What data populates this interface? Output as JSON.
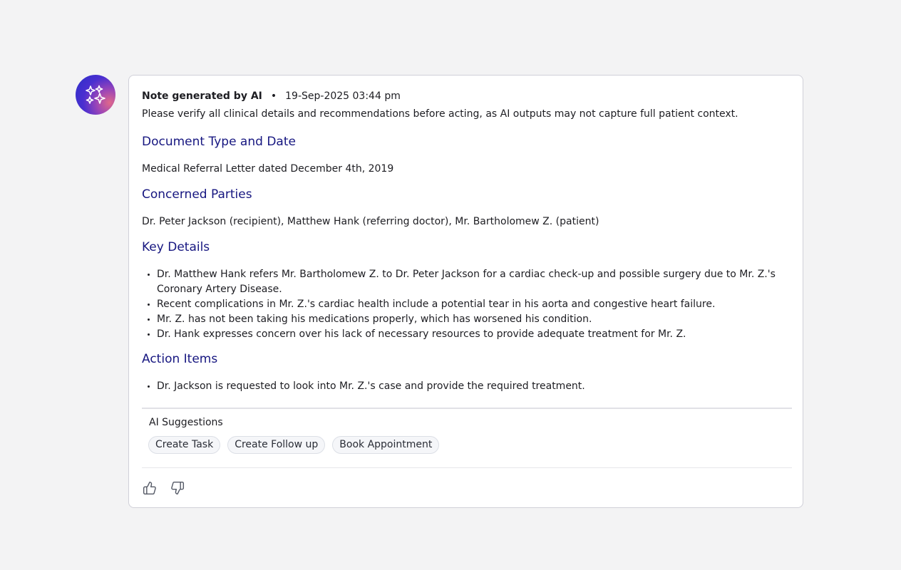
{
  "note": {
    "generated_label": "Note generated by AI",
    "separator": "•",
    "timestamp": "19-Sep-2025 03:44 pm",
    "disclaimer": "Please verify all clinical details and recommendations before acting, as AI outputs may not capture full patient context."
  },
  "sections": {
    "document_type": {
      "title": "Document Type and Date",
      "text": "Medical Referral Letter dated December 4th, 2019"
    },
    "concerned_parties": {
      "title": "Concerned Parties",
      "text": "Dr. Peter Jackson (recipient), Matthew Hank (referring doctor), Mr. Bartholomew Z. (patient)"
    },
    "key_details": {
      "title": "Key Details",
      "items": [
        "Dr. Matthew Hank refers Mr. Bartholomew Z. to Dr. Peter Jackson for a cardiac check-up and possible surgery due to Mr. Z.'s Coronary Artery Disease.",
        "Recent complications in Mr. Z.'s cardiac health include a potential tear in his aorta and congestive heart failure.",
        "Mr. Z. has not been taking his medications properly, which has worsened his condition.",
        "Dr. Hank expresses concern over his lack of necessary resources to provide adequate treatment for Mr. Z."
      ]
    },
    "action_items": {
      "title": "Action Items",
      "items": [
        "Dr. Jackson is requested to look into Mr. Z.'s case and provide the required treatment."
      ]
    }
  },
  "suggestions": {
    "title": "AI Suggestions",
    "chips": [
      "Create Task",
      "Create Follow up",
      "Book Appointment"
    ]
  },
  "icons": {
    "avatar": "sparkles-icon",
    "like": "thumbs-up-icon",
    "dislike": "thumbs-down-icon"
  },
  "colors": {
    "heading": "#161680",
    "avatar_start": "#2a2fc8",
    "avatar_end": "#e0688a"
  }
}
